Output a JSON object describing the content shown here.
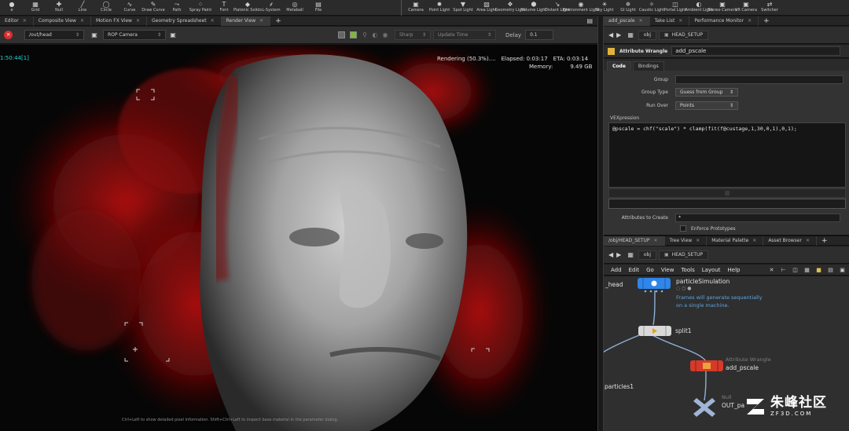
{
  "shelf": {
    "tools": [
      {
        "icon": "sphere-icon",
        "glyph": "●",
        "label": "e"
      },
      {
        "icon": "grid-icon",
        "glyph": "▦",
        "label": "Grid"
      },
      {
        "icon": "null-icon",
        "glyph": "✚",
        "label": "Null"
      },
      {
        "icon": "line-icon",
        "glyph": "╱",
        "label": "Line"
      },
      {
        "icon": "circle-icon",
        "glyph": "◯",
        "label": "Circle"
      },
      {
        "icon": "curve-icon",
        "glyph": "∿",
        "label": "Curve"
      },
      {
        "icon": "draw-curve-icon",
        "glyph": "✎",
        "label": "Draw Curve"
      },
      {
        "icon": "path-icon",
        "glyph": "⤳",
        "label": "Path"
      },
      {
        "icon": "spray-paint-icon",
        "glyph": "⁘",
        "label": "Spray Paint"
      },
      {
        "icon": "font-icon",
        "glyph": "T",
        "label": "Font"
      },
      {
        "icon": "platonic-solids-icon",
        "glyph": "◆",
        "label": "Platonic Solids"
      },
      {
        "icon": "l-system-icon",
        "glyph": "⸙",
        "label": "L-System"
      },
      {
        "icon": "metaball-icon",
        "glyph": "◎",
        "label": "Metaball"
      },
      {
        "icon": "file-icon",
        "glyph": "▤",
        "label": "File"
      }
    ],
    "lights": [
      {
        "icon": "camera-icon",
        "glyph": "▣",
        "label": "Camera"
      },
      {
        "icon": "point-light-icon",
        "glyph": "✹",
        "label": "Point Light"
      },
      {
        "icon": "spot-light-icon",
        "glyph": "▼",
        "label": "Spot Light"
      },
      {
        "icon": "area-light-icon",
        "glyph": "▧",
        "label": "Area Light"
      },
      {
        "icon": "geometry-light-icon",
        "glyph": "❖",
        "label": "Geometry Light"
      },
      {
        "icon": "volume-light-icon",
        "glyph": "⬢",
        "label": "Volume Light"
      },
      {
        "icon": "distant-light-icon",
        "glyph": "↘",
        "label": "Distant Light"
      },
      {
        "icon": "environment-light-icon",
        "glyph": "◉",
        "label": "Environment Light"
      },
      {
        "icon": "sky-light-icon",
        "glyph": "☀",
        "label": "Sky Light"
      },
      {
        "icon": "gi-light-icon",
        "glyph": "✵",
        "label": "GI Light"
      },
      {
        "icon": "caustic-light-icon",
        "glyph": "✧",
        "label": "Caustic Light"
      },
      {
        "icon": "portal-light-icon",
        "glyph": "◫",
        "label": "Portal Light"
      },
      {
        "icon": "ambient-light-icon",
        "glyph": "◐",
        "label": "Ambient Light"
      },
      {
        "icon": "stereo-camera-icon",
        "glyph": "▣",
        "label": "Stereo Camera"
      },
      {
        "icon": "vr-camera-icon",
        "glyph": "▣",
        "label": "VR Camera"
      },
      {
        "icon": "switcher-icon",
        "glyph": "⇄",
        "label": "Switcher"
      }
    ]
  },
  "left_pane": {
    "tabs": [
      {
        "label": "Editor",
        "active": false
      },
      {
        "label": "Composite View",
        "active": false
      },
      {
        "label": "Motion FX View",
        "active": false
      },
      {
        "label": "Geometry Spreadsheet",
        "active": false
      },
      {
        "label": "Render View",
        "active": true
      }
    ],
    "toolbar": {
      "output_path": "/out/head",
      "camera": "ROP Camera",
      "sharp_label": "Sharp",
      "update_label": "Update Time",
      "delay_label": "Delay",
      "delay_value": "0.1"
    },
    "render": {
      "timecode": "1:50:44[1]",
      "status": "Rendering (50.3%)....",
      "elapsed": "Elapsed: 0:03:17",
      "eta": "ETA: 0:03:14",
      "memory_label": "Memory:",
      "memory_value": "9.49 GB",
      "hint": "Ctrl+Left to show detailed pixel information. Shift+Ctrl+Left to inspect base material in the parameter dialog."
    }
  },
  "right_top": {
    "tabs": [
      {
        "label": "add_pscale",
        "active": true
      },
      {
        "label": "Take List",
        "active": false
      },
      {
        "label": "Performance Monitor",
        "active": false
      }
    ],
    "path": {
      "context": "obj",
      "node": "HEAD_SETUP"
    },
    "node_type": "Attribute Wrangle",
    "node_name": "add_pscale",
    "parm_tabs": [
      {
        "label": "Code",
        "active": true
      },
      {
        "label": "Bindings",
        "active": false
      }
    ],
    "params": {
      "group_label": "Group",
      "group_type_label": "Group Type",
      "group_type_value": "Guess from Group",
      "run_over_label": "Run Over",
      "run_over_value": "Points",
      "vex_label": "VEXpression",
      "vex_code": "@pscale = chf(\"scale\") * clamp(fit(f@custage,1,30,0,1),0,1);",
      "attributes_label": "Attributes to Create",
      "attributes_value": "*",
      "enforce_label": "Enforce Prototypes"
    }
  },
  "right_bottom": {
    "tabs": [
      {
        "label": "/obj/HEAD_SETUP",
        "active": true
      },
      {
        "label": "Tree View",
        "active": false
      },
      {
        "label": "Material Palette",
        "active": false
      },
      {
        "label": "Asset Browser",
        "active": false
      }
    ],
    "path": {
      "context": "obj",
      "node": "HEAD_SETUP"
    },
    "menu": [
      "Add",
      "Edit",
      "Go",
      "View",
      "Tools",
      "Layout",
      "Help"
    ],
    "nodes": {
      "head_label": "_head",
      "particles_label": "particles1",
      "sim_name": "particleSimulation",
      "sim_comment_1": "Frames will generate sequentially",
      "sim_comment_2": "on a single machine.",
      "split_name": "split1",
      "wrangle_type": "Attribute Wrangle",
      "wrangle_name": "add_pscale",
      "null_type": "Null",
      "null_name": "OUT_pa"
    },
    "colors": {
      "sim": "#2f86e8",
      "wrangle": "#d63a2a",
      "null": "#9fb5d6"
    }
  },
  "watermark": {
    "brand": "朱峰社区",
    "url": "ZF3D.COM"
  }
}
